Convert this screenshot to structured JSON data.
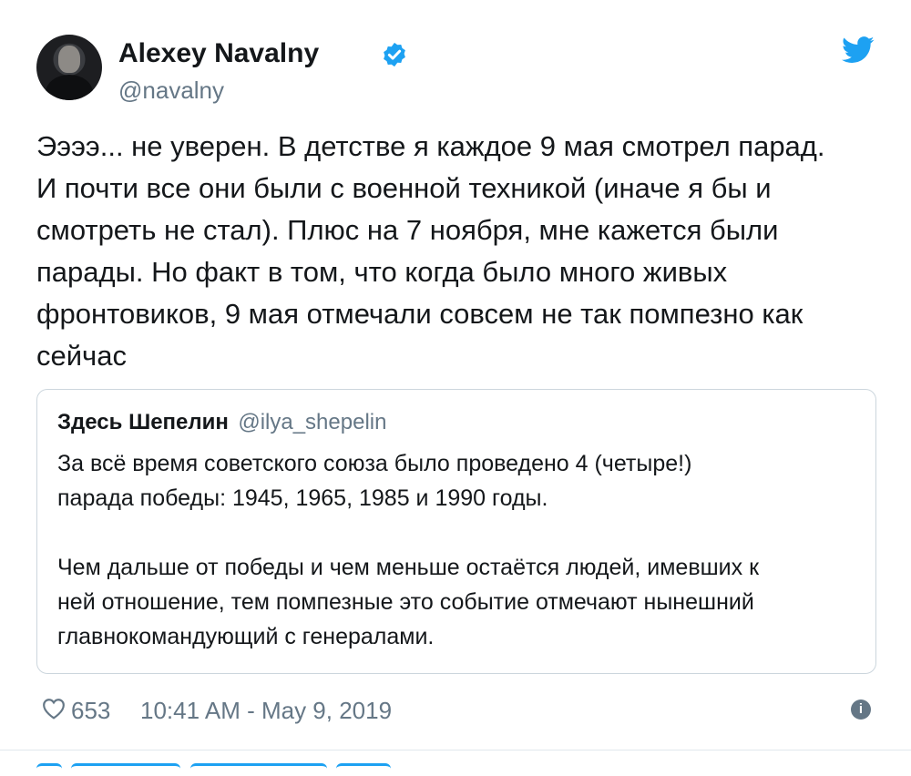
{
  "author": {
    "display_name": "Alexey Navalny",
    "handle": "@navalny",
    "verified": true
  },
  "tweet": {
    "text": "Ээээ... не уверен. В детстве я каждое 9 мая смотрел парад.\nИ почти все они были с военной техникой (иначе я бы и\nсмотреть не стал). Плюс на 7 ноября, мне кажется были\nпарады. Но факт в том, что когда было много живых\nфронтовиков, 9 мая отмечали совсем не так помпезно как\nсейчас"
  },
  "quoted_tweet": {
    "display_name": "Здесь Шепелин",
    "handle": "@ilya_shepelin",
    "text": "За всё время советского союза было проведено 4 (четыре!)\nпарада победы: 1945, 1965, 1985 и 1990 годы.\n\nЧем дальше от победы и чем меньше остаётся людей, имевших к\nней отношение, тем помпезные это событие отмечают нынешний\nглавнокомандующий с генералами."
  },
  "footer": {
    "like_count": "653",
    "timestamp": "10:41 AM - May 9, 2019",
    "info_glyph": "i"
  },
  "colors": {
    "twitter_blue": "#1da1f2",
    "secondary_text": "#657786",
    "border": "#ccd6dd"
  },
  "icons": [
    "verified-icon",
    "twitter-bird-icon",
    "heart-icon",
    "info-icon"
  ]
}
